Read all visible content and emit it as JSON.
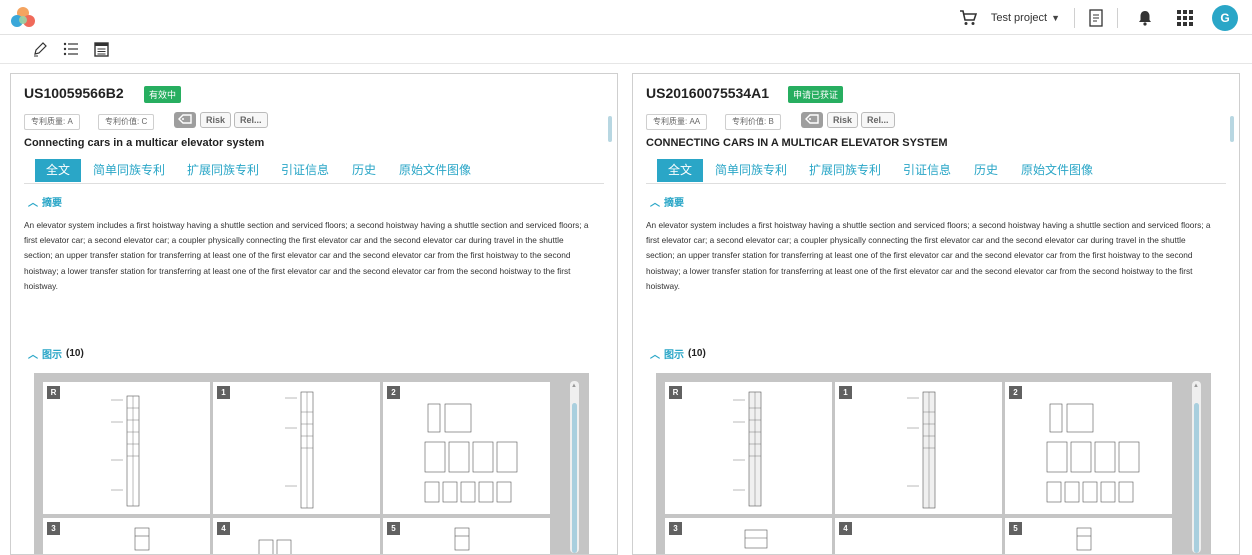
{
  "topbar": {
    "project_label": "Test project",
    "avatar_letter": "G",
    "icons": [
      "cart-icon",
      "document-icon",
      "bell-icon",
      "apps-grid-icon"
    ]
  },
  "toolbar": {
    "icons": [
      "highlighter-icon",
      "list-icon",
      "document-view-icon"
    ]
  },
  "panels": [
    {
      "patent_number": "US10059566B2",
      "status": "有效中",
      "quality_chip": "专利质量: A",
      "value_chip": "专利价值: C",
      "risk_label": "Risk",
      "rel_label": "Rel...",
      "title": "Connecting cars in a multicar elevator system",
      "tabs": [
        "全文",
        "简单同族专利",
        "扩展同族专利",
        "引证信息",
        "历史",
        "原始文件图像"
      ],
      "abstract_heading": "摘要",
      "abstract": "An elevator system includes a first hoistway having a shuttle section and serviced floors; a second hoistway having a shuttle section and serviced floors; a first elevator car; a second elevator car; a coupler physically connecting the first elevator car and the second elevator car during travel in the shuttle section; an upper transfer station for transferring at least one of the first elevator car and the second elevator car from the first hoistway to the second hoistway; a lower transfer station for transferring at least one of the first elevator car and the second elevator car from the second hoistway to the first hoistway.",
      "figures_heading": "图示",
      "figures_count": "(10)",
      "figure_labels": [
        "R",
        "1",
        "2",
        "3",
        "4",
        "5"
      ]
    },
    {
      "patent_number": "US20160075534A1",
      "status": "申请已获证",
      "quality_chip": "专利质量: AA",
      "value_chip": "专利价值: B",
      "risk_label": "Risk",
      "rel_label": "Rel...",
      "title": "CONNECTING CARS IN A MULTICAR ELEVATOR SYSTEM",
      "tabs": [
        "全文",
        "简单同族专利",
        "扩展同族专利",
        "引证信息",
        "历史",
        "原始文件图像"
      ],
      "abstract_heading": "摘要",
      "abstract": "An elevator system includes a first hoistway having a shuttle section and serviced floors; a second hoistway having a shuttle section and serviced floors; a first elevator car; a second elevator car; a coupler physically connecting the first elevator car and the second elevator car during travel in the shuttle section; an upper transfer station for transferring at least one of the first elevator car and the second elevator car from the first hoistway to the second hoistway; a lower transfer station for transferring at least one of the first elevator car and the second elevator car from the second hoistway to the first hoistway.",
      "figures_heading": "图示",
      "figures_count": "(10)",
      "figure_labels": [
        "R",
        "1",
        "2",
        "3",
        "4",
        "5"
      ]
    }
  ],
  "colors": {
    "accent": "#2aa6c7",
    "status_green": "#27ae60",
    "avatar": "#2aa6c7"
  }
}
